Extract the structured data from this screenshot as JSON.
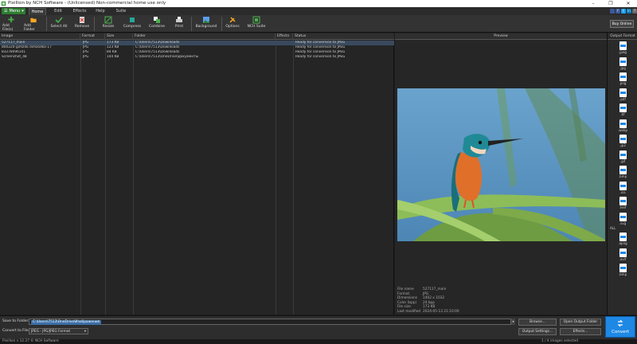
{
  "window": {
    "title": "Pixillion by NCH Software - (Unlicensed) Non-commercial home use only",
    "controls": [
      "–",
      "❐",
      "✕"
    ]
  },
  "menu_button": "Menu",
  "tabs": [
    {
      "label": "Home",
      "active": true
    },
    {
      "label": "Edit",
      "active": false
    },
    {
      "label": "Effects",
      "active": false
    },
    {
      "label": "Help",
      "active": false
    },
    {
      "label": "Suite",
      "active": false
    }
  ],
  "toolbar": {
    "add_files": "Add File(s)",
    "add_folder": "Add Folder",
    "select_all": "Select All",
    "remove": "Remove",
    "resize": "Resize",
    "compress": "Compress",
    "combine": "Combine",
    "print": "Print",
    "background": "Background",
    "options": "Options",
    "nch_suite": "NCH Suite",
    "buy_online": "Buy Online"
  },
  "file_list": {
    "columns": [
      "Image",
      "Format",
      "Size",
      "Folder",
      "Effects",
      "Status"
    ],
    "rows": [
      {
        "image": "527117_main",
        "format": "JPG",
        "size": "173 KB",
        "folder": "C:\\Users\\7513\\Downloads",
        "effects": "",
        "status": "Ready for conversion to JPEG",
        "selected": true
      },
      {
        "image": "800220-gimzdo dimzodka-17",
        "format": "JPG",
        "size": "123 KB",
        "folder": "C:\\Users\\7513\\Downloads",
        "effects": "",
        "status": "Ready for conversion to JPEG",
        "selected": false
      },
      {
        "image": "83278096101",
        "format": "JPG",
        "size": "84 KB",
        "folder": "C:\\Users\\7513\\Downloads",
        "effects": "",
        "status": "Ready for conversion to JPEG",
        "selected": false
      },
      {
        "image": "Screenshot_48",
        "format": "JPG",
        "size": "144 KB",
        "folder": "C:\\Users\\7513\\OneDrive\\Документы",
        "effects": "",
        "status": "Ready for conversion to JPEG",
        "selected": false
      }
    ]
  },
  "preview": {
    "title": "Preview",
    "meta": [
      {
        "k": "File name",
        "v": "527117_main"
      },
      {
        "k": "Format",
        "v": "JPG"
      },
      {
        "k": "Dimensions",
        "v": "1402 x 1032"
      },
      {
        "k": "Color (bpp)",
        "v": "24 bpp"
      },
      {
        "k": "File size",
        "v": "173 KB"
      },
      {
        "k": "Last modified",
        "v": "2024-05-13 21:10:00"
      }
    ]
  },
  "output_format": {
    "title": "Output Format",
    "formats": [
      ".jpeg",
      ".jpg",
      ".png",
      ".pdf",
      ".tif",
      ".webp",
      ".jp2",
      ".gif",
      ".bmp",
      ".ico",
      ".heif",
      ".svg"
    ],
    "all_label": "ALL",
    "more_formats": [
      ".apng",
      ".avif",
      ".bmp"
    ]
  },
  "bottom": {
    "save_to_folder_label": "Save to Folder:",
    "save_to_folder_value": "C:\\Users\\7513\\OneDrive\\Изображения",
    "convert_to_label": "Convert to File:",
    "convert_to_value": "JPEG - JPG/JPEG Format",
    "browse": "Browse...",
    "open_output_folder": "Open Output Folder",
    "output_settings": "Output Settings...",
    "effects": "Effects...",
    "convert": "Convert"
  },
  "status": {
    "left": "Pixillion v 12.27 © NCH Software",
    "right": "1 / 4 images selected"
  },
  "colors": {
    "accent_green": "#2e7d32",
    "convert_blue": "#1e88e5",
    "selection": "#3a4a5c"
  }
}
